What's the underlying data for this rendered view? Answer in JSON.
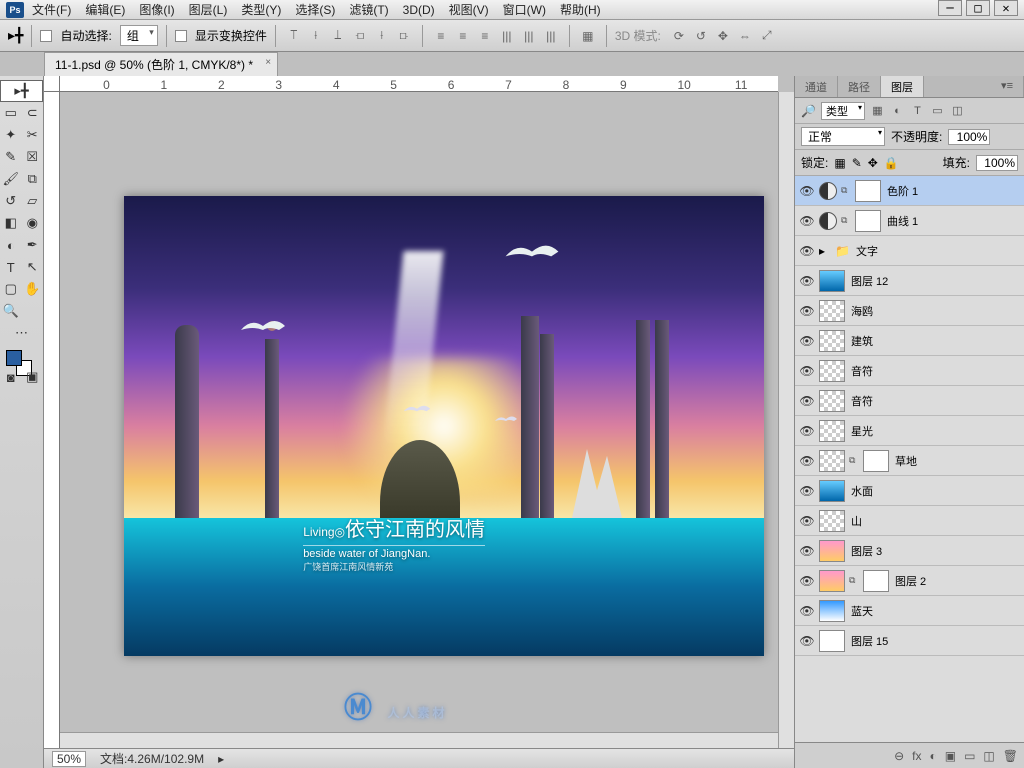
{
  "menu": {
    "items": [
      "文件(F)",
      "编辑(E)",
      "图像(I)",
      "图层(L)",
      "类型(Y)",
      "选择(S)",
      "滤镜(T)",
      "3D(D)",
      "视图(V)",
      "窗口(W)",
      "帮助(H)"
    ]
  },
  "options": {
    "autoSelect": "自动选择:",
    "group": "组",
    "showTransform": "显示变换控件",
    "mode3d": "3D 模式:"
  },
  "docTab": "11-1.psd @ 50% (色阶 1, CMYK/8*) *",
  "ruler": [
    "0",
    "1",
    "2",
    "3",
    "4",
    "5",
    "6",
    "7",
    "8",
    "9",
    "10",
    "11"
  ],
  "artwork": {
    "title": "Living",
    "ring": "◎",
    "subtitle_cn": "依守江南的风情",
    "subtitle_en": "beside water of JiangNan.",
    "tagline": "广饶首席江南风情新苑"
  },
  "watermark": "人人素材",
  "status": {
    "zoom": "50%",
    "docinfo": "文档:4.26M/102.9M"
  },
  "panelTabs": [
    "通道",
    "路径",
    "图层"
  ],
  "filterRow": {
    "label": "类型"
  },
  "blendRow": {
    "mode": "正常",
    "opacityLabel": "不透明度:",
    "opacity": "100%"
  },
  "lockRow": {
    "label": "锁定:",
    "fillLabel": "填充:",
    "fill": "100%"
  },
  "layers": [
    {
      "name": "色阶 1",
      "type": "adj",
      "active": true
    },
    {
      "name": "曲线 1",
      "type": "adj"
    },
    {
      "name": "文字",
      "type": "group"
    },
    {
      "name": "图层 12",
      "type": "img",
      "thumb": "water"
    },
    {
      "name": "海鸥",
      "type": "img",
      "thumb": "trans"
    },
    {
      "name": "建筑",
      "type": "img",
      "thumb": "trans"
    },
    {
      "name": "音符",
      "type": "img",
      "thumb": "trans"
    },
    {
      "name": "音符",
      "type": "img",
      "thumb": "trans"
    },
    {
      "name": "星光",
      "type": "img",
      "thumb": "trans"
    },
    {
      "name": "草地",
      "type": "img",
      "thumb": "trans",
      "mask": true
    },
    {
      "name": "水面",
      "type": "img",
      "thumb": "water"
    },
    {
      "name": "山",
      "type": "img",
      "thumb": "trans"
    },
    {
      "name": "图层 3",
      "type": "img",
      "thumb": "sunset"
    },
    {
      "name": "图层 2",
      "type": "img",
      "thumb": "sunset",
      "mask": true
    },
    {
      "name": "蓝天",
      "type": "img",
      "thumb": "sky"
    },
    {
      "name": "图层 15",
      "type": "img",
      "thumb": "white"
    }
  ],
  "footerIcons": [
    "⊖",
    "fx",
    "◐",
    "▣",
    "▭",
    "◫",
    "🗑"
  ]
}
